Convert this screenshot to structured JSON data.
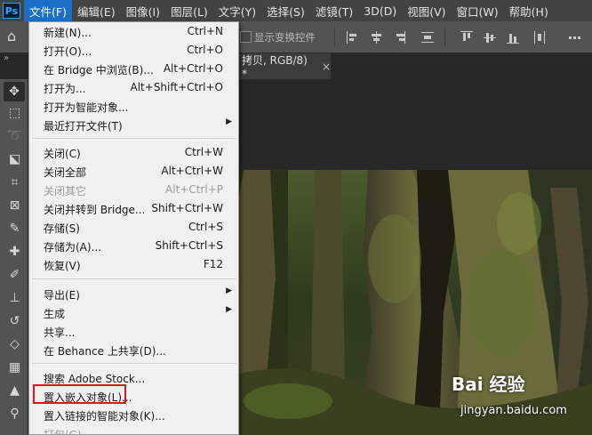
{
  "app": {
    "logo_text": "Ps"
  },
  "menubar": {
    "items": [
      "文件(F)",
      "编辑(E)",
      "图像(I)",
      "图层(L)",
      "文字(Y)",
      "选择(S)",
      "滤镜(T)",
      "3D(D)",
      "视图(V)",
      "窗口(W)",
      "帮助(H)"
    ],
    "active_index": 0
  },
  "options": {
    "transform_controls_label": "显示变换控件",
    "transform_controls_checked": false
  },
  "tabs": {
    "collapse_glyph": "»",
    "doc_tab_label": "拷贝, RGB/8) *",
    "close_glyph": "×"
  },
  "file_menu": {
    "items": [
      {
        "label": "新建(N)...",
        "shortcut": "Ctrl+N"
      },
      {
        "label": "打开(O)...",
        "shortcut": "Ctrl+O"
      },
      {
        "label": "在 Bridge 中浏览(B)...",
        "shortcut": "Alt+Ctrl+O"
      },
      {
        "label": "打开为...",
        "shortcut": "Alt+Shift+Ctrl+O"
      },
      {
        "label": "打开为智能对象...",
        "shortcut": ""
      },
      {
        "label": "最近打开文件(T)",
        "shortcut": "",
        "submenu": true
      },
      {
        "label": "关闭(C)",
        "shortcut": "Ctrl+W"
      },
      {
        "label": "关闭全部",
        "shortcut": "Alt+Ctrl+W"
      },
      {
        "label": "关闭其它",
        "shortcut": "Alt+Ctrl+P",
        "disabled": true
      },
      {
        "label": "关闭并转到 Bridge...",
        "shortcut": "Shift+Ctrl+W"
      },
      {
        "label": "存储(S)",
        "shortcut": "Ctrl+S"
      },
      {
        "label": "存储为(A)...",
        "shortcut": "Shift+Ctrl+S"
      },
      {
        "label": "恢复(V)",
        "shortcut": "F12"
      },
      {
        "label": "导出(E)",
        "shortcut": "",
        "submenu": true
      },
      {
        "label": "生成",
        "shortcut": "",
        "submenu": true
      },
      {
        "label": "共享...",
        "shortcut": ""
      },
      {
        "label": "在 Behance 上共享(D)...",
        "shortcut": ""
      },
      {
        "label": "搜索 Adobe Stock...",
        "shortcut": ""
      },
      {
        "label": "置入嵌入对象(L)...",
        "shortcut": "",
        "highlighted": true
      },
      {
        "label": "置入链接的智能对象(K)...",
        "shortcut": ""
      },
      {
        "label": "打包(G)...",
        "shortcut": ""
      }
    ],
    "submenu_glyph": "▶",
    "highlight_color": "#e3151b"
  },
  "watermark": {
    "logo": "Bai 经验",
    "url": "jingyan.baidu.com"
  }
}
